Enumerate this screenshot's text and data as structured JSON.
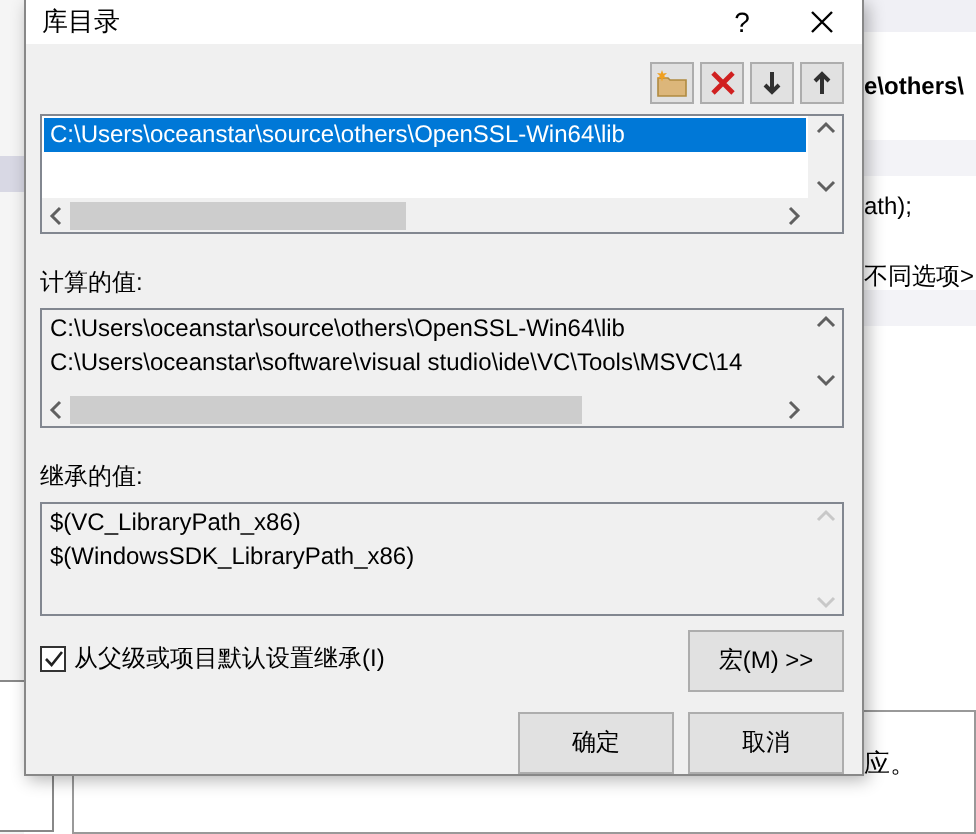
{
  "background": {
    "texts": [
      {
        "kind": "bold",
        "text": "e\\others\\"
      },
      {
        "kind": "plain",
        "text": "ath);"
      },
      {
        "kind": "plain",
        "text": "不同选项>"
      },
      {
        "kind": "plain",
        "text": "应。"
      }
    ]
  },
  "dialog": {
    "title": "库目录",
    "help": "?",
    "directories": {
      "items": [
        {
          "text": "C:\\Users\\oceanstar\\source\\others\\OpenSSL-Win64\\lib",
          "selected": true
        }
      ]
    },
    "computed": {
      "label": "计算的值:",
      "lines": [
        "C:\\Users\\oceanstar\\source\\others\\OpenSSL-Win64\\lib",
        "C:\\Users\\oceanstar\\software\\visual studio\\ide\\VC\\Tools\\MSVC\\14"
      ]
    },
    "inherited": {
      "label": "继承的值:",
      "lines": [
        "$(VC_LibraryPath_x86)",
        "$(WindowsSDK_LibraryPath_x86)"
      ]
    },
    "inherit_checkbox": {
      "label": "从父级或项目默认设置继承(I)",
      "checked": true
    },
    "macros_button": "宏(M) >>",
    "buttons": [
      "确定",
      "取消"
    ]
  }
}
